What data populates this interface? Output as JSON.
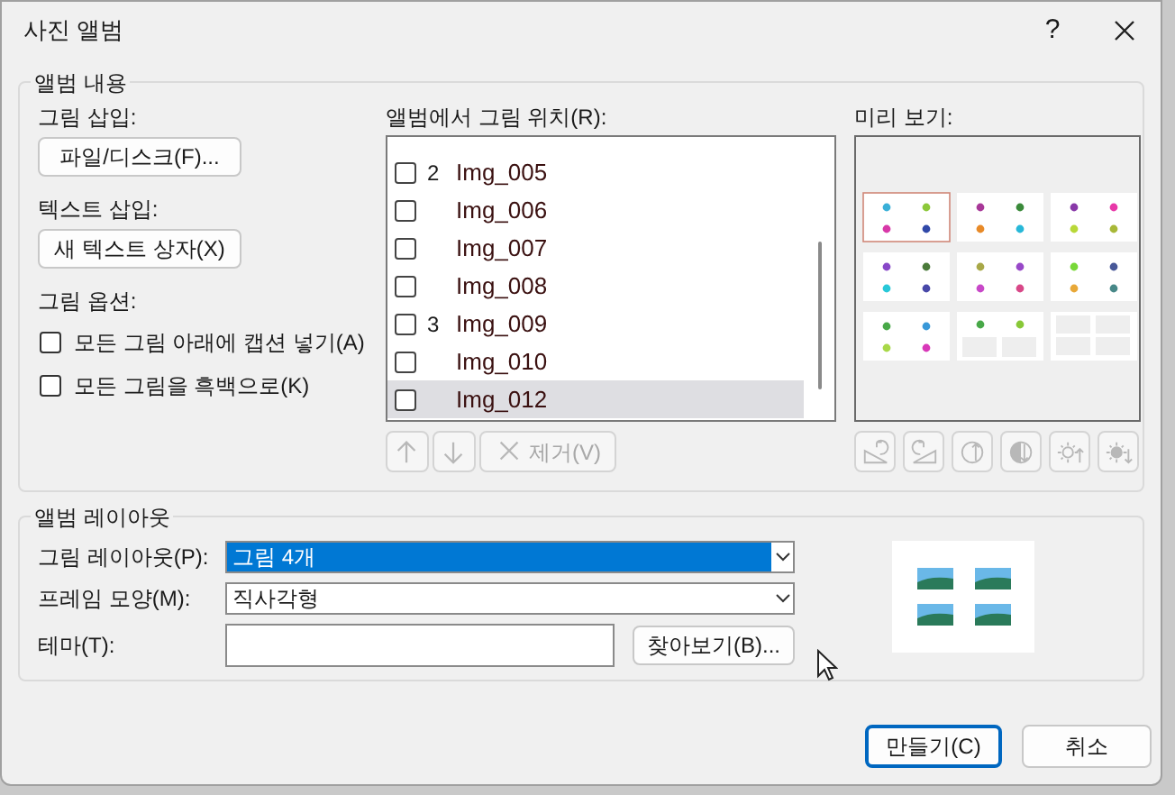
{
  "window": {
    "title": "사진 앨범",
    "help": "?"
  },
  "album_content": {
    "title": "앨범 내용",
    "insert_picture": {
      "label": "그림 삽입:",
      "button": "파일/디스크(F)..."
    },
    "insert_text": {
      "label": "텍스트 삽입:",
      "button": "새 텍스트 상자(X)"
    },
    "picture_options": {
      "label": "그림 옵션:",
      "options": [
        {
          "label": "모든 그림 아래에 캡션 넣기(A)",
          "checked": false
        },
        {
          "label": "모든 그림을 흑백으로(K)",
          "checked": false
        }
      ]
    },
    "list": {
      "label": "앨범에서 그림 위치(R):",
      "rows": [
        {
          "slide": "2",
          "name": "Img_005",
          "checked": false,
          "selected": false
        },
        {
          "name": "Img_006",
          "checked": false,
          "selected": false
        },
        {
          "name": "Img_007",
          "checked": false,
          "selected": false
        },
        {
          "name": "Img_008",
          "checked": false,
          "selected": false
        },
        {
          "slide": "3",
          "name": "Img_009",
          "checked": false,
          "selected": false
        },
        {
          "name": "Img_010",
          "checked": false,
          "selected": false
        },
        {
          "name": "Img_012",
          "checked": false,
          "selected": true
        }
      ]
    },
    "list_buttons": [
      {
        "kind": "up",
        "disabled": true
      },
      {
        "kind": "down",
        "disabled": true
      },
      {
        "kind": "remove",
        "label": "제거(V)",
        "disabled": true
      }
    ],
    "preview": {
      "label": "미리 보기:",
      "tools": [
        {
          "kind": "rotate-left",
          "disabled": true
        },
        {
          "kind": "rotate-right",
          "disabled": true
        },
        {
          "kind": "contrast-up",
          "disabled": true
        },
        {
          "kind": "contrast-down",
          "disabled": true
        },
        {
          "kind": "brightness-up",
          "disabled": true
        },
        {
          "kind": "brightness-down",
          "disabled": true
        }
      ]
    }
  },
  "album_layout": {
    "title": "앨범 레이아웃",
    "picture_layout": {
      "label": "그림 레이아웃(P):",
      "value": "그림 4개",
      "focused": true
    },
    "frame_shape": {
      "label": "프레임 모양(M):",
      "value": "직사각형",
      "focused": false
    },
    "theme": {
      "label": "테마(T):"
    },
    "browse_button": "찾아보기(B)..."
  },
  "buttons": [
    {
      "label": "만들기(C)",
      "default": true
    },
    {
      "label": "취소",
      "default": false
    }
  ]
}
